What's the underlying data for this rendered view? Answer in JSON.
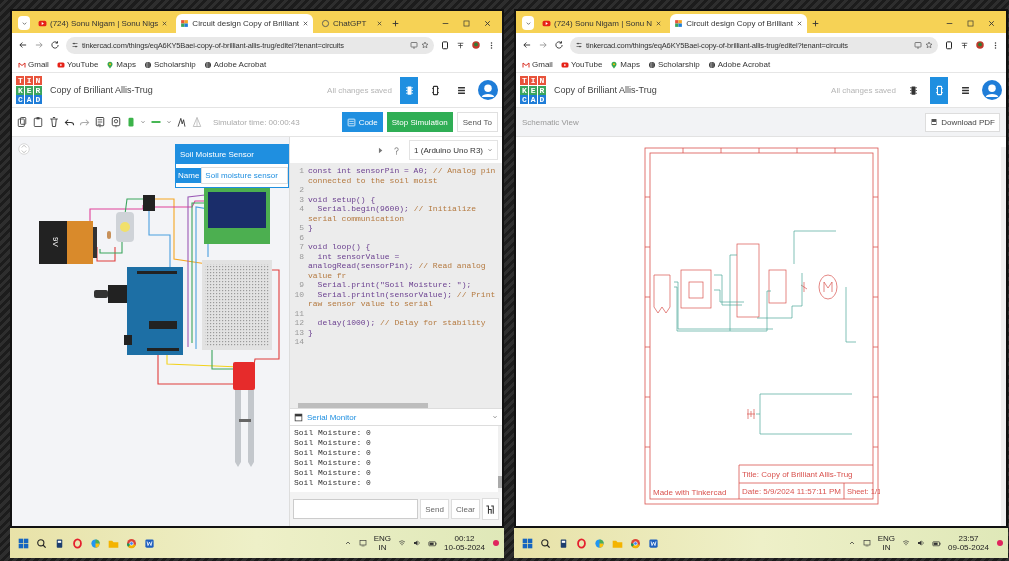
{
  "windows": [
    {
      "kind": "circuit_editor",
      "tabs": [
        {
          "kind": "youtube",
          "title": "(724) Sonu Nigam | Sonu Nigs",
          "selected": false
        },
        {
          "kind": "tinkercad",
          "title": "Circuit design Copy of Brilliant",
          "selected": true
        },
        {
          "kind": "chatgpt",
          "title": "ChatGPT",
          "selected": false
        }
      ],
      "url": "tinkercad.com/things/eqA6KY5Baei-copy-of-brilliant-allis-trug/editel?tenant=circuits",
      "bookmarks": [
        {
          "kind": "gmail",
          "label": "Gmail"
        },
        {
          "kind": "youtube",
          "label": "YouTube"
        },
        {
          "kind": "maps",
          "label": "Maps"
        },
        {
          "kind": "globe",
          "label": "Scholarship"
        },
        {
          "kind": "globe",
          "label": "Adobe Acrobat"
        }
      ],
      "logo_rows": [
        "TIN",
        "KER",
        "CAD"
      ],
      "project_title": "Copy of Brilliant Allis-Trug",
      "save_status": "All changes saved",
      "views": [
        {
          "kind": "circuit",
          "selected": true
        },
        {
          "kind": "schematic",
          "selected": false
        },
        {
          "kind": "list",
          "selected": false
        }
      ],
      "editor": {
        "simulator_time": "Simulator time: 00:00:43",
        "buttons": [
          {
            "kind": "code",
            "label": "Code"
          },
          {
            "kind": "stop",
            "label": "Stop Simulation"
          },
          {
            "kind": "plain",
            "label": "Send To"
          }
        ],
        "battery_label": "9V",
        "inspector": {
          "title": "Soil Moisture Sensor",
          "field_label": "Name",
          "field_value": "Soil moisture sensor"
        },
        "device": "1 (Arduino Uno R3)",
        "code_lines": [
          {
            "number": "1",
            "code": "const int sensorPin = A0;",
            "comment": "// Analog pin connected to the soil moist"
          },
          {
            "number": "2"
          },
          {
            "number": "3",
            "code": "void setup() {"
          },
          {
            "number": "4",
            "code": "  Serial.begin(9600);",
            "comment": "// Initialize serial communication"
          },
          {
            "number": "5",
            "code": "}"
          },
          {
            "number": "6"
          },
          {
            "number": "7",
            "code": "void loop() {"
          },
          {
            "number": "8",
            "code": "  int sensorValue = analogRead(sensorPin);",
            "comment": "// Read analog value fr"
          },
          {
            "number": "9",
            "code": "  Serial.print(\"Soil Moisture: \");"
          },
          {
            "number": "10",
            "code": "  Serial.println(sensorValue);",
            "comment": "// Print raw sensor value to serial"
          },
          {
            "number": "11"
          },
          {
            "number": "12",
            "code": "  delay(1000);",
            "comment": "// Delay for stability"
          },
          {
            "number": "13",
            "code": "}"
          },
          {
            "number": "14"
          }
        ],
        "serial_monitor": {
          "title": "Serial Monitor",
          "output": [
            "Soil Moisture: 0",
            "Soil Moisture: 0",
            "Soil Moisture: 0",
            "Soil Moisture: 0",
            "Soil Moisture: 0",
            "Soil Moisture: 0"
          ],
          "buttons": [
            "Send",
            "Clear"
          ]
        }
      },
      "taskbar": {
        "language": "ENG",
        "region": "IN",
        "time": "00:12",
        "date": "10-05-2024"
      }
    },
    {
      "kind": "schematic",
      "tabs": [
        {
          "kind": "youtube",
          "title": "(724) Sonu Nigam | Sonu N",
          "selected": false
        },
        {
          "kind": "tinkercad",
          "title": "Circuit design Copy of Brilliant",
          "selected": true
        }
      ],
      "url": "tinkercad.com/things/eqA6KY5Baei-copy-of-brilliant-allis-trug/editel?tenant=circuits",
      "bookmarks": [
        {
          "kind": "gmail",
          "label": "Gmail"
        },
        {
          "kind": "youtube",
          "label": "YouTube"
        },
        {
          "kind": "maps",
          "label": "Maps"
        },
        {
          "kind": "globe",
          "label": "Scholarship"
        },
        {
          "kind": "globe",
          "label": "Adobe Acrobat"
        }
      ],
      "logo_rows": [
        "TIN",
        "KER",
        "CAD"
      ],
      "project_title": "Copy of Brilliant Allis-Trug",
      "save_status": "All changes saved",
      "views": [
        {
          "kind": "circuit",
          "selected": false
        },
        {
          "kind": "schematic",
          "selected": true
        },
        {
          "kind": "list",
          "selected": false
        }
      ],
      "schematic": {
        "title": "Schematic View",
        "download": "Download PDF",
        "made_with": "Made with Tinkercad",
        "sheet_title": "Title: Copy of Brilliant Allis-Trug",
        "date": "Date: 5/9/2024 11:57:11 PM",
        "sheet": "Sheet: 1/1"
      },
      "taskbar": {
        "language": "ENG",
        "region": "IN",
        "time": "23:57",
        "date": "09-05-2024"
      }
    }
  ]
}
